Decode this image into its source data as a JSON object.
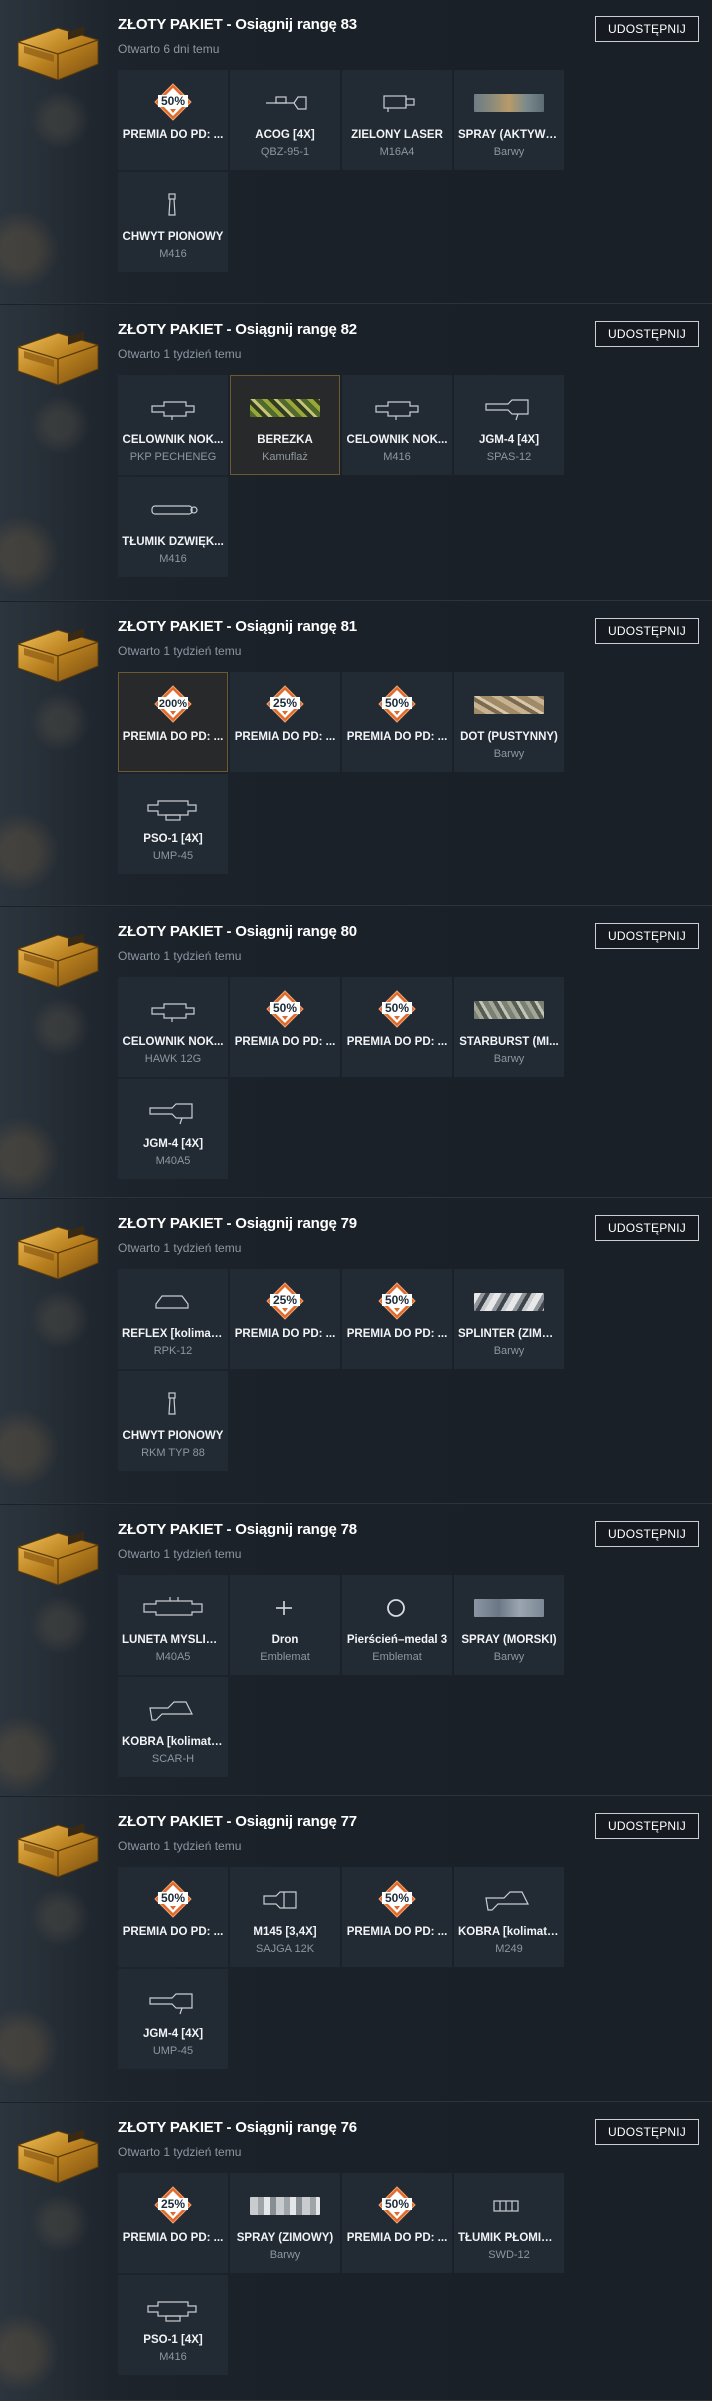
{
  "share_label": "UDOSTĘPNIJ",
  "packs": [
    {
      "title": "ZŁOTY PAKIET - Osiągnij rangę 83",
      "opened": "Otwarto 6 dni temu",
      "items": [
        {
          "icon": "premium-50-badge",
          "badge": "50",
          "name": "PREMIA DO PD: ...",
          "sub": ""
        },
        {
          "icon": "acog-scope-icon",
          "name": "ACOG [4X]",
          "sub": "QBZ-95-1"
        },
        {
          "icon": "laser-sight-icon",
          "name": "ZIELONY LASER",
          "sub": "M16A4"
        },
        {
          "icon": "camo-swatch",
          "camo": "active",
          "name": "SPRAY (AKTYWNY)",
          "sub": "Barwy"
        },
        {
          "icon": "vertical-grip-icon",
          "name": "CHWYT PIONOWY",
          "sub": "M416"
        }
      ]
    },
    {
      "title": "ZŁOTY PAKIET - Osiągnij rangę 82",
      "opened": "Otwarto 1 tydzień temu",
      "items": [
        {
          "icon": "scope-icon",
          "name": "CELOWNIK NOK...",
          "sub": "PKP PECHENEG"
        },
        {
          "icon": "camo-swatch",
          "camo": "berezka",
          "name": "BEREZKA",
          "sub": "Kamuflaż",
          "highlight": true
        },
        {
          "icon": "scope-icon",
          "name": "CELOWNIK NOK...",
          "sub": "M416"
        },
        {
          "icon": "jgm-scope-icon",
          "name": "JGM-4 [4X]",
          "sub": "SPAS-12"
        },
        {
          "icon": "suppressor-icon",
          "name": "TŁUMIK DŹWIĘK...",
          "sub": "M416"
        }
      ]
    },
    {
      "title": "ZŁOTY PAKIET - Osiągnij rangę 81",
      "opened": "Otwarto 1 tydzień temu",
      "items": [
        {
          "icon": "premium-200-badge",
          "badge": "200",
          "name": "PREMIA DO PD: ...",
          "sub": "",
          "highlight": true
        },
        {
          "icon": "premium-25-badge",
          "badge": "25",
          "name": "PREMIA DO PD: ...",
          "sub": ""
        },
        {
          "icon": "premium-50-badge",
          "badge": "50",
          "name": "PREMIA DO PD: ...",
          "sub": ""
        },
        {
          "icon": "camo-swatch",
          "camo": "desert",
          "name": "DOT (PUSTYNNY)",
          "sub": "Barwy"
        },
        {
          "icon": "pso-scope-icon",
          "name": "PSO-1 [4X]",
          "sub": "UMP-45"
        }
      ]
    },
    {
      "title": "ZŁOTY PAKIET - Osiągnij rangę 80",
      "opened": "Otwarto 1 tydzień temu",
      "items": [
        {
          "icon": "scope-icon",
          "name": "CELOWNIK NOK...",
          "sub": "HAWK 12G"
        },
        {
          "icon": "premium-50-badge",
          "badge": "50",
          "name": "PREMIA DO PD: ...",
          "sub": ""
        },
        {
          "icon": "premium-50-badge",
          "badge": "50",
          "name": "PREMIA DO PD: ...",
          "sub": ""
        },
        {
          "icon": "camo-swatch",
          "camo": "starburst",
          "name": "STARBURST (MI...",
          "sub": "Barwy"
        },
        {
          "icon": "jgm-scope-icon",
          "name": "JGM-4 [4X]",
          "sub": "M40A5"
        }
      ]
    },
    {
      "title": "ZŁOTY PAKIET - Osiągnij rangę 79",
      "opened": "Otwarto 1 tydzień temu",
      "items": [
        {
          "icon": "reflex-sight-icon",
          "name": "REFLEX [kolimator]",
          "sub": "RPK-12"
        },
        {
          "icon": "premium-25-badge",
          "badge": "25",
          "name": "PREMIA DO PD: ...",
          "sub": ""
        },
        {
          "icon": "premium-50-badge",
          "badge": "50",
          "name": "PREMIA DO PD: ...",
          "sub": ""
        },
        {
          "icon": "camo-swatch",
          "camo": "splinter",
          "name": "SPLINTER (ZIMO...",
          "sub": "Barwy"
        },
        {
          "icon": "vertical-grip-icon",
          "name": "CHWYT PIONOWY",
          "sub": "RKM TYP 88"
        }
      ]
    },
    {
      "title": "ZŁOTY PAKIET - Osiągnij rangę 78",
      "opened": "Otwarto 1 tydzień temu",
      "items": [
        {
          "icon": "hunting-scope-icon",
          "name": "LUNETA MYŚLIW...",
          "sub": "M40A5"
        },
        {
          "icon": "drone-emblem-icon",
          "name": "Dron",
          "sub": "Emblemat"
        },
        {
          "icon": "ring-emblem-icon",
          "name": "Pierścień–medal 3",
          "sub": "Emblemat"
        },
        {
          "icon": "camo-swatch",
          "camo": "naval",
          "name": "SPRAY (MORSKI)",
          "sub": "Barwy"
        },
        {
          "icon": "kobra-sight-icon",
          "name": "KOBRA [kolimator]",
          "sub": "SCAR-H"
        }
      ]
    },
    {
      "title": "ZŁOTY PAKIET - Osiągnij rangę 77",
      "opened": "Otwarto 1 tydzień temu",
      "items": [
        {
          "icon": "premium-50-badge",
          "badge": "50",
          "name": "PREMIA DO PD: ...",
          "sub": ""
        },
        {
          "icon": "m145-scope-icon",
          "name": "M145 [3,4X]",
          "sub": "SAJGA 12K"
        },
        {
          "icon": "premium-50-badge",
          "badge": "50",
          "name": "PREMIA DO PD: ...",
          "sub": ""
        },
        {
          "icon": "kobra-sight-icon",
          "name": "KOBRA [kolimator]",
          "sub": "M249"
        },
        {
          "icon": "jgm-scope-icon",
          "name": "JGM-4 [4X]",
          "sub": "UMP-45"
        }
      ]
    },
    {
      "title": "ZŁOTY PAKIET - Osiągnij rangę 76",
      "opened": "Otwarto 1 tydzień temu",
      "items": [
        {
          "icon": "premium-25-badge",
          "badge": "25",
          "name": "PREMIA DO PD: ...",
          "sub": ""
        },
        {
          "icon": "camo-swatch",
          "camo": "winter",
          "name": "SPRAY (ZIMOWY)",
          "sub": "Barwy"
        },
        {
          "icon": "premium-50-badge",
          "badge": "50",
          "name": "PREMIA DO PD: ...",
          "sub": ""
        },
        {
          "icon": "flash-hider-icon",
          "name": "TŁUMIK PŁOMIENIA",
          "sub": "SWD-12"
        },
        {
          "icon": "pso-scope-icon",
          "name": "PSO-1 [4X]",
          "sub": "M416"
        }
      ]
    }
  ]
}
